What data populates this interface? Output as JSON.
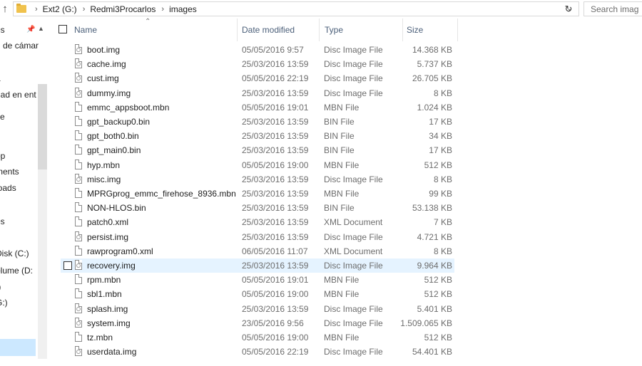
{
  "address": {
    "crumbs": [
      "Ext2 (G:)",
      "Redmi3Procarlos",
      "images"
    ],
    "search_placeholder": "Search imag"
  },
  "nav": {
    "items": [
      "es",
      "n de cámar",
      "a",
      "dad en ent",
      "ve",
      "op",
      "ments",
      "loads",
      "es",
      "s",
      "Disk (C:)",
      "olume (D:",
      ":)",
      "G:)",
      ")"
    ]
  },
  "columns": {
    "name": "Name",
    "date": "Date modified",
    "type": "Type",
    "size": "Size"
  },
  "files": [
    {
      "name": "boot.img",
      "date": "05/05/2016 9:57",
      "type": "Disc Image File",
      "size": "14.368 KB",
      "icon": "disc-image-icon"
    },
    {
      "name": "cache.img",
      "date": "25/03/2016 13:59",
      "type": "Disc Image File",
      "size": "5.737 KB",
      "icon": "disc-image-icon"
    },
    {
      "name": "cust.img",
      "date": "05/05/2016 22:19",
      "type": "Disc Image File",
      "size": "26.705 KB",
      "icon": "disc-image-icon"
    },
    {
      "name": "dummy.img",
      "date": "25/03/2016 13:59",
      "type": "Disc Image File",
      "size": "8 KB",
      "icon": "disc-image-icon"
    },
    {
      "name": "emmc_appsboot.mbn",
      "date": "05/05/2016 19:01",
      "type": "MBN File",
      "size": "1.024 KB",
      "icon": "file-icon"
    },
    {
      "name": "gpt_backup0.bin",
      "date": "25/03/2016 13:59",
      "type": "BIN File",
      "size": "17 KB",
      "icon": "file-icon"
    },
    {
      "name": "gpt_both0.bin",
      "date": "25/03/2016 13:59",
      "type": "BIN File",
      "size": "34 KB",
      "icon": "file-icon"
    },
    {
      "name": "gpt_main0.bin",
      "date": "25/03/2016 13:59",
      "type": "BIN File",
      "size": "17 KB",
      "icon": "file-icon"
    },
    {
      "name": "hyp.mbn",
      "date": "05/05/2016 19:00",
      "type": "MBN File",
      "size": "512 KB",
      "icon": "file-icon"
    },
    {
      "name": "misc.img",
      "date": "25/03/2016 13:59",
      "type": "Disc Image File",
      "size": "8 KB",
      "icon": "disc-image-icon"
    },
    {
      "name": "MPRGprog_emmc_firehose_8936.mbn",
      "date": "25/03/2016 13:59",
      "type": "MBN File",
      "size": "99 KB",
      "icon": "file-icon"
    },
    {
      "name": "NON-HLOS.bin",
      "date": "25/03/2016 13:59",
      "type": "BIN File",
      "size": "53.138 KB",
      "icon": "file-icon"
    },
    {
      "name": "patch0.xml",
      "date": "25/03/2016 13:59",
      "type": "XML Document",
      "size": "7 KB",
      "icon": "xml-icon"
    },
    {
      "name": "persist.img",
      "date": "25/03/2016 13:59",
      "type": "Disc Image File",
      "size": "4.721 KB",
      "icon": "disc-image-icon"
    },
    {
      "name": "rawprogram0.xml",
      "date": "06/05/2016 11:07",
      "type": "XML Document",
      "size": "8 KB",
      "icon": "xml-icon"
    },
    {
      "name": "recovery.img",
      "date": "25/03/2016 13:59",
      "type": "Disc Image File",
      "size": "9.964 KB",
      "icon": "disc-image-icon",
      "selected": true
    },
    {
      "name": "rpm.mbn",
      "date": "05/05/2016 19:01",
      "type": "MBN File",
      "size": "512 KB",
      "icon": "file-icon"
    },
    {
      "name": "sbl1.mbn",
      "date": "05/05/2016 19:00",
      "type": "MBN File",
      "size": "512 KB",
      "icon": "file-icon"
    },
    {
      "name": "splash.img",
      "date": "25/03/2016 13:59",
      "type": "Disc Image File",
      "size": "5.401 KB",
      "icon": "disc-image-icon"
    },
    {
      "name": "system.img",
      "date": "23/05/2016 9:56",
      "type": "Disc Image File",
      "size": "1.509.065 KB",
      "icon": "disc-image-icon"
    },
    {
      "name": "tz.mbn",
      "date": "05/05/2016 19:00",
      "type": "MBN File",
      "size": "512 KB",
      "icon": "file-icon"
    },
    {
      "name": "userdata.img",
      "date": "05/05/2016 22:19",
      "type": "Disc Image File",
      "size": "54.401 KB",
      "icon": "disc-image-icon"
    }
  ]
}
